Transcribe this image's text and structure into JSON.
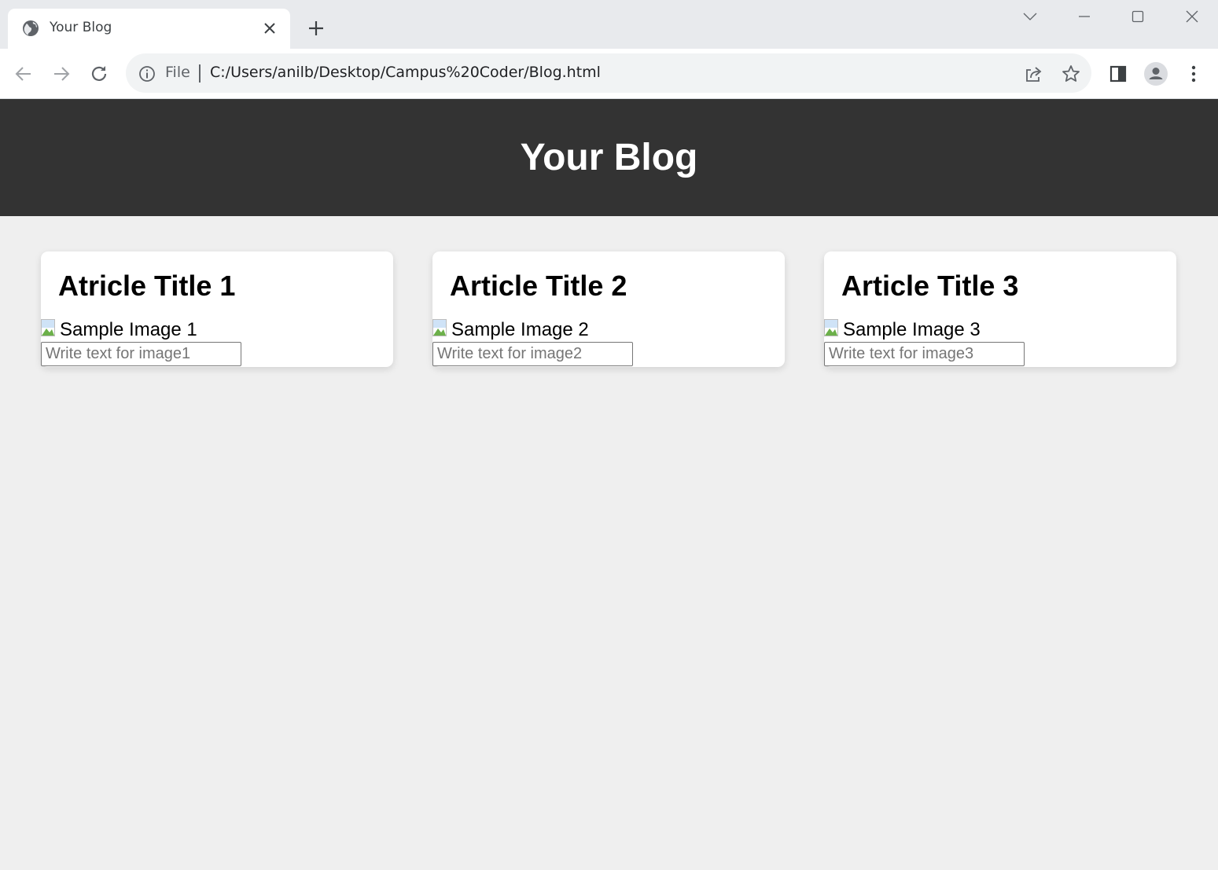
{
  "browser": {
    "tab_title": "Your Blog",
    "scheme_label": "File",
    "url": "C:/Users/anilb/Desktop/Campus%20Coder/Blog.html"
  },
  "header": {
    "title": "Your Blog"
  },
  "articles": [
    {
      "title": "Atricle Title 1",
      "image_alt": "Sample Image 1",
      "placeholder": "Write text for image1"
    },
    {
      "title": "Article Title 2",
      "image_alt": "Sample Image 2",
      "placeholder": "Write text for image2"
    },
    {
      "title": "Article Title 3",
      "image_alt": "Sample Image 3",
      "placeholder": "Write text for image3"
    }
  ],
  "colors": {
    "header_bg": "#333333",
    "page_bg": "#efefef",
    "card_bg": "#ffffff"
  }
}
